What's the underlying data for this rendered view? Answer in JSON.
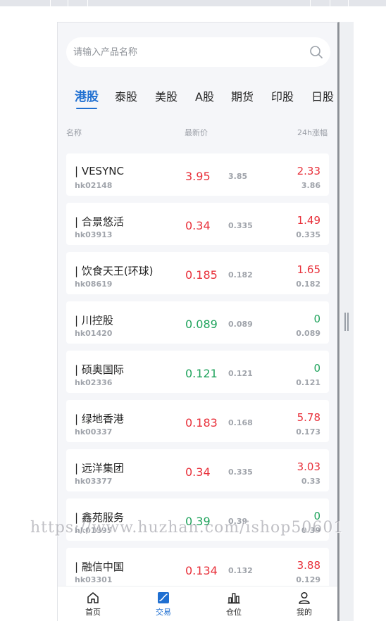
{
  "search": {
    "placeholder": "请输入产品名称"
  },
  "tabs": [
    {
      "label": "港股",
      "active": true
    },
    {
      "label": "泰股"
    },
    {
      "label": "美股"
    },
    {
      "label": "A股"
    },
    {
      "label": "期货"
    },
    {
      "label": "印股"
    },
    {
      "label": "日股"
    }
  ],
  "columns": {
    "name": "名称",
    "price": "最新价",
    "change": "24h涨幅"
  },
  "rows": [
    {
      "name": "| VESYNC",
      "code": "hk02148",
      "price": "3.95",
      "prev": "3.85",
      "change": "2.33",
      "change_sub": "3.86",
      "trend": "up"
    },
    {
      "name": "| 合景悠活",
      "code": "hk03913",
      "price": "0.34",
      "prev": "0.335",
      "change": "1.49",
      "change_sub": "0.335",
      "trend": "up"
    },
    {
      "name": "| 饮食天王(环球)",
      "code": "hk08619",
      "price": "0.185",
      "prev": "0.182",
      "change": "1.65",
      "change_sub": "0.182",
      "trend": "up"
    },
    {
      "name": "| 川控股",
      "code": "hk01420",
      "price": "0.089",
      "prev": "0.089",
      "change": "0",
      "change_sub": "0.089",
      "trend": "down"
    },
    {
      "name": "| 硕奥国际",
      "code": "hk02336",
      "price": "0.121",
      "prev": "0.121",
      "change": "0",
      "change_sub": "0.121",
      "trend": "down"
    },
    {
      "name": "| 绿地香港",
      "code": "hk00337",
      "price": "0.183",
      "prev": "0.168",
      "change": "5.78",
      "change_sub": "0.173",
      "trend": "up"
    },
    {
      "name": "| 远洋集团",
      "code": "hk03377",
      "price": "0.34",
      "prev": "0.335",
      "change": "3.03",
      "change_sub": "0.33",
      "trend": "up"
    },
    {
      "name": "| 鑫苑服务",
      "code": "hk01895",
      "price": "0.39",
      "prev": "0.39",
      "change": "0",
      "change_sub": "0.39",
      "trend": "down"
    },
    {
      "name": "| 融信中国",
      "code": "hk03301",
      "price": "0.134",
      "prev": "0.132",
      "change": "3.88",
      "change_sub": "0.129",
      "trend": "up"
    }
  ],
  "nav": [
    {
      "label": "首页",
      "icon": "home-icon"
    },
    {
      "label": "交易",
      "icon": "trade-icon",
      "active": true
    },
    {
      "label": "仓位",
      "icon": "position-icon"
    },
    {
      "label": "我的",
      "icon": "user-icon"
    }
  ],
  "colors": {
    "accent": "#1f6fd1",
    "up": "#e8303a",
    "down": "#1fa35c"
  },
  "watermark": "https://www.huzhan.com/ishop50601"
}
